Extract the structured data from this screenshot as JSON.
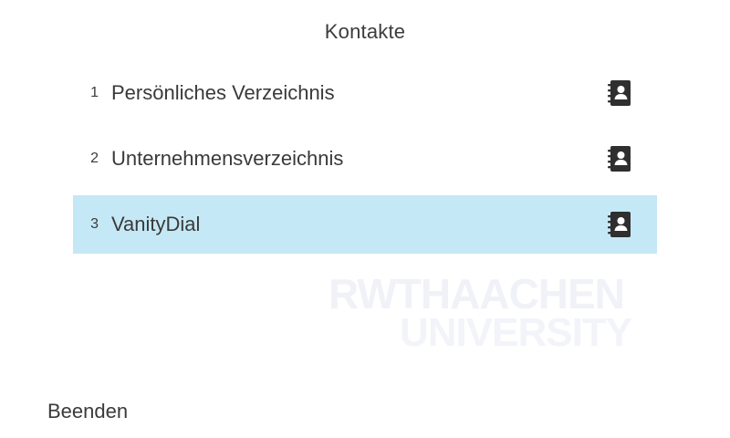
{
  "header": {
    "title": "Kontakte"
  },
  "contacts": {
    "items": [
      {
        "number": "1",
        "label": "Persönliches Verzeichnis",
        "icon": "address-book-icon",
        "selected": false
      },
      {
        "number": "2",
        "label": "Unternehmensverzeichnis",
        "icon": "address-book-icon",
        "selected": false
      },
      {
        "number": "3",
        "label": "VanityDial",
        "icon": "address-book-icon",
        "selected": true
      }
    ]
  },
  "watermark": {
    "line1": "RWTHAACHEN",
    "line2": "UNIVERSITY"
  },
  "softkeys": {
    "exit_label": "Beenden"
  },
  "colors": {
    "selected_background": "#c5e8f6",
    "text": "#3a3a3a",
    "icon": "#2f2f2f"
  }
}
